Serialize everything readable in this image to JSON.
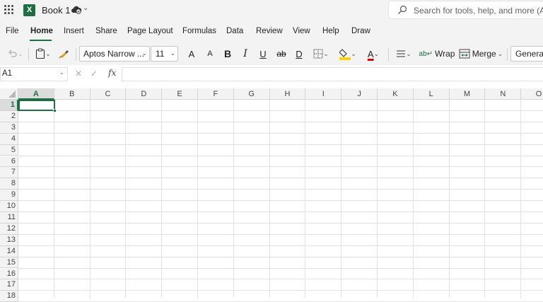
{
  "titlebar": {
    "app_icon": "excel-logo",
    "app_letter": "X",
    "doc_title": "Book 1",
    "search_placeholder": "Search for tools, help, and more (Alt + Q)"
  },
  "tabs": [
    "File",
    "Home",
    "Insert",
    "Share",
    "Page Layout",
    "Formulas",
    "Data",
    "Review",
    "View",
    "Help",
    "Draw"
  ],
  "active_tab": "Home",
  "ribbon": {
    "font_name": "Aptos Narrow ...",
    "font_size": "11",
    "increase_font": "A",
    "decrease_font": "A",
    "bold": "B",
    "italic": "I",
    "underline": "U",
    "strike": "ab",
    "double_underline": "D",
    "font_color": "A",
    "wrap_label": "Wrap",
    "merge_label": "Merge",
    "number_format": "General"
  },
  "formula_bar": {
    "name_box": "A1",
    "fx_label": "fx",
    "formula": ""
  },
  "grid": {
    "columns": [
      "A",
      "B",
      "C",
      "D",
      "E",
      "F",
      "G",
      "H",
      "I",
      "J",
      "K",
      "L",
      "M",
      "N",
      "O"
    ],
    "rows": [
      "1",
      "2",
      "3",
      "4",
      "5",
      "6",
      "7",
      "8",
      "9",
      "10",
      "11",
      "12",
      "13",
      "14",
      "15",
      "16",
      "17",
      "18"
    ],
    "active_cell": "A1"
  },
  "colors": {
    "accent": "#1d6f42",
    "fill_color": "#ffd400",
    "font_color": "#e00000"
  }
}
